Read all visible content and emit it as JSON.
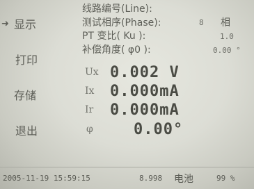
{
  "menu": {
    "items": [
      {
        "label": "显示",
        "selected": true
      },
      {
        "label": "打印",
        "selected": false
      },
      {
        "label": "存储",
        "selected": false
      },
      {
        "label": "退出",
        "selected": false
      }
    ],
    "selector_icon": "arrow-right-icon"
  },
  "params": {
    "line_label": "线路编号(Line):",
    "phase_label": "测试相序(Phase):",
    "phase_value": "8",
    "phase_unit": "相",
    "pt_label": "PT 变比( Ku ):",
    "pt_value": "1.0",
    "angle_label": "补偿角度( φ0 ):",
    "angle_value": "0.00 °"
  },
  "readings": {
    "ux": {
      "symbol": "Ux",
      "value": "0.002 V"
    },
    "ix": {
      "symbol": "Ix",
      "value": "0.000mA"
    },
    "ir": {
      "symbol": "Ir",
      "value": "0.000mA"
    },
    "phi": {
      "symbol": "φ",
      "value": "0.00°"
    }
  },
  "status": {
    "datetime": "2005-11-19 15:59:15",
    "voltage": "8.998",
    "battery_label": "电池",
    "battery_value": "99 %"
  }
}
